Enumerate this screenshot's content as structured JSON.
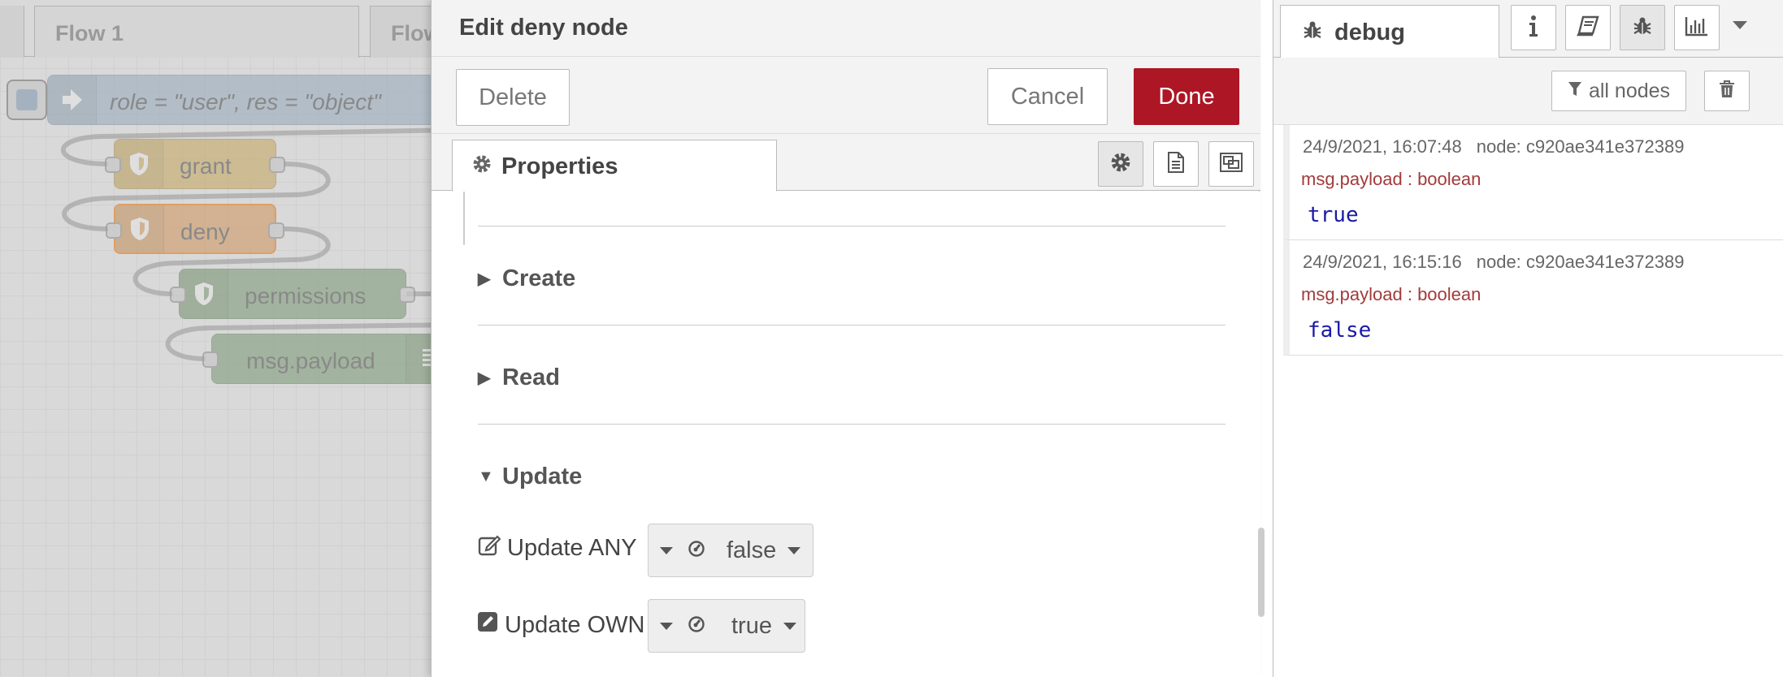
{
  "workspace": {
    "tabs": [
      {
        "label": "Flow 1"
      },
      {
        "label": "Flow"
      }
    ],
    "nodes": {
      "inject": "role = \"user\", res = \"object\"",
      "grant": "grant",
      "deny": "deny",
      "permissions": "permissions",
      "debug": "msg.payload"
    }
  },
  "tray": {
    "title": "Edit deny node",
    "delete_label": "Delete",
    "cancel_label": "Cancel",
    "done_label": "Done",
    "properties_tab": "Properties",
    "sections": {
      "create": "Create",
      "read": "Read",
      "update": "Update"
    },
    "update_any": {
      "label": "Update ANY",
      "value": "false"
    },
    "update_own": {
      "label": "Update OWN",
      "value": "true"
    }
  },
  "sidebar": {
    "tab_label": "debug",
    "filter_label": "all nodes",
    "messages": [
      {
        "timestamp": "24/9/2021, 16:07:48",
        "node": "node: c920ae341e372389",
        "topic": "msg.payload : boolean",
        "value": "true"
      },
      {
        "timestamp": "24/9/2021, 16:15:16",
        "node": "node: c920ae341e372389",
        "topic": "msg.payload : boolean",
        "value": "false"
      }
    ]
  },
  "colors": {
    "done_button": "#ad1625",
    "deny_node_highlight": "#ff7f0e",
    "debug_value": "#1a1aa6",
    "debug_topic": "#a23b3b"
  }
}
